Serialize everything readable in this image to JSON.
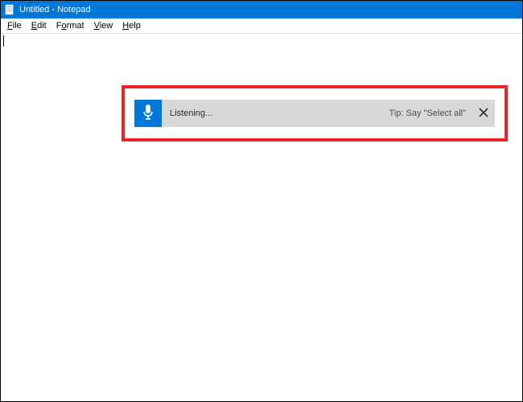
{
  "window": {
    "title": "Untitled - Notepad"
  },
  "menu": {
    "file": {
      "label": "File",
      "hotkey": "F"
    },
    "edit": {
      "label": "Edit",
      "hotkey": "E"
    },
    "format": {
      "label": "Format",
      "hotkey": "o"
    },
    "view": {
      "label": "View",
      "hotkey": "V"
    },
    "help": {
      "label": "Help",
      "hotkey": "H"
    }
  },
  "dictation": {
    "status": "Listening...",
    "tip": "Tip: Say \"Select all\""
  },
  "icons": {
    "app": "notepad-icon",
    "mic": "microphone-icon",
    "close": "close-icon"
  },
  "colors": {
    "titlebar": "#0178d7",
    "accent": "#0178d7",
    "highlight": "#e6242a",
    "bar_bg": "#d8d8d8"
  }
}
